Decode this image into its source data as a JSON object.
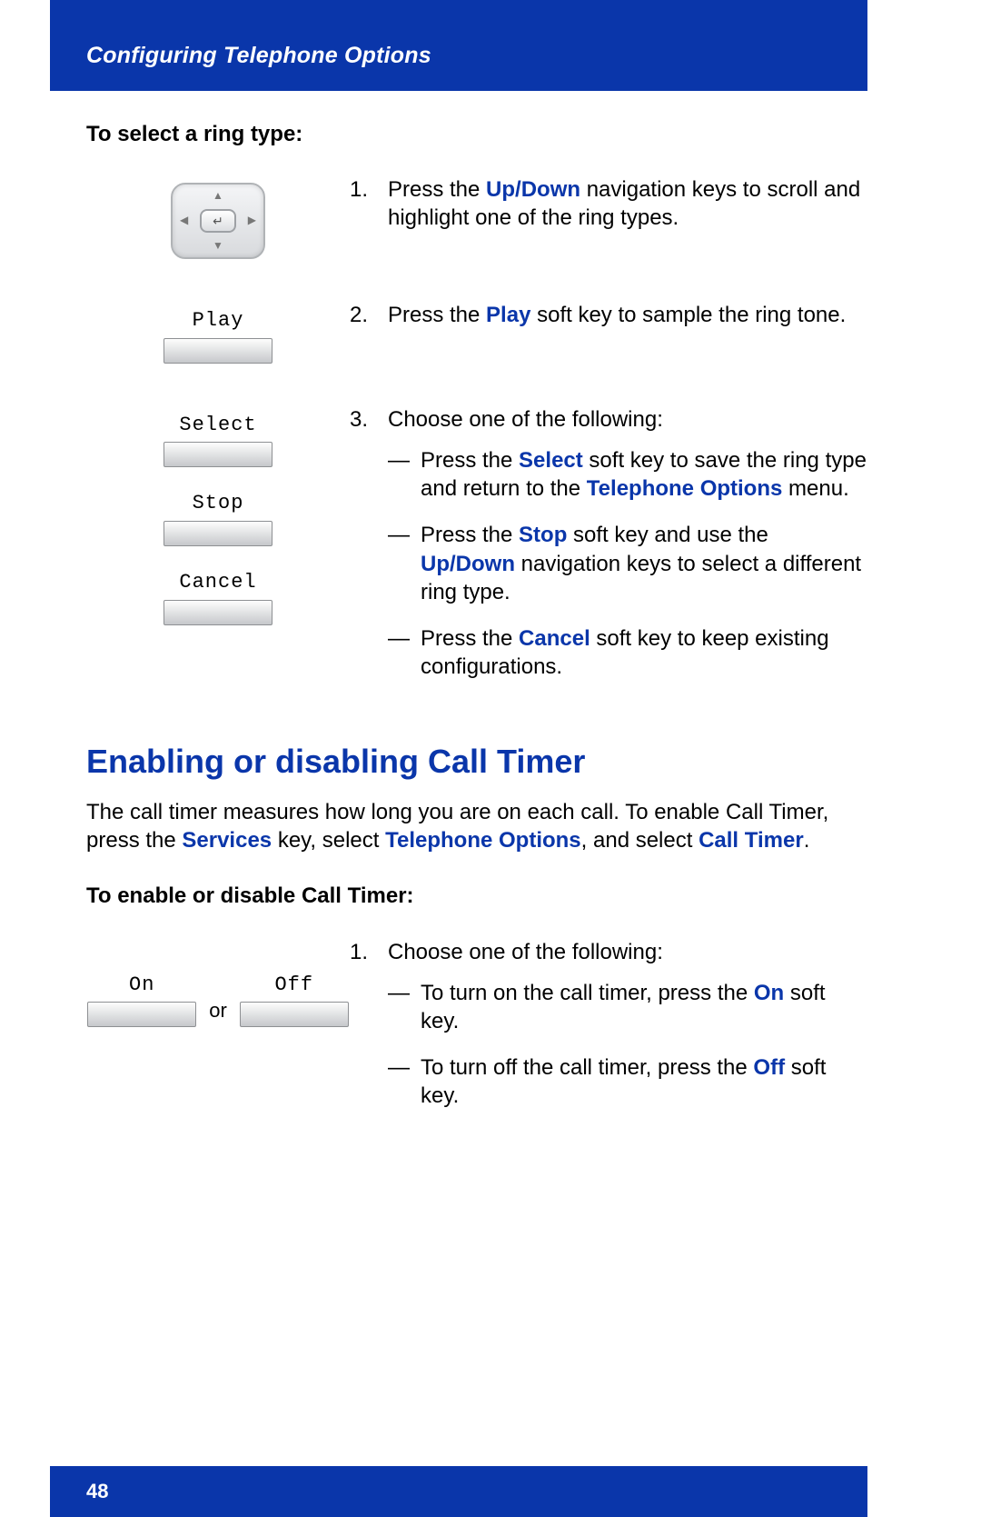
{
  "header": {
    "title": "Configuring Telephone Options"
  },
  "section1": {
    "subhead": "To select a ring type:",
    "steps": {
      "s1": {
        "num": "1.",
        "t1": "Press the ",
        "hl1": "Up/Down",
        "t2": " navigation keys to scroll and highlight one of the ring types."
      },
      "s2": {
        "num": "2.",
        "label": "Play",
        "t1": "Press the ",
        "hl1": "Play",
        "t2": " soft key to sample the ring tone."
      },
      "s3": {
        "num": "3.",
        "labels": {
          "a": "Select",
          "b": "Stop",
          "c": "Cancel"
        },
        "intro": "Choose one of the following:",
        "a": {
          "dash": "—",
          "t1": "Press the ",
          "hl1": "Select",
          "t2": " soft key to save the ring type and return to the ",
          "hl2": "Telephone Options",
          "t3": " menu."
        },
        "b": {
          "dash": "—",
          "t1": "Press the ",
          "hl1": "Stop",
          "t2": " soft key and use the ",
          "hl2": "Up/Down",
          "t3": " navigation keys to select a different ring type."
        },
        "c": {
          "dash": "—",
          "t1": "Press the ",
          "hl1": "Cancel",
          "t2": " soft key to keep existing configurations."
        }
      }
    }
  },
  "section2": {
    "title": "Enabling or disabling Call Timer",
    "para": {
      "t1": "The call timer measures how long you are on each call. To enable Call Timer, press the ",
      "hl1": "Services",
      "t2": " key, select ",
      "hl2": "Telephone Options",
      "t3": ", and select ",
      "hl3": "Call Timer",
      "t4": "."
    },
    "subhead": "To enable or disable Call Timer:",
    "step": {
      "num": "1.",
      "labels": {
        "on": "On",
        "off": "Off",
        "or": "or"
      },
      "intro": "Choose one of the following:",
      "a": {
        "dash": "—",
        "t1": "To turn on the call timer, press the ",
        "hl1": "On",
        "t2": " soft key."
      },
      "b": {
        "dash": "—",
        "t1": "To turn off the call timer, press the ",
        "hl1": "Off",
        "t2": " soft key."
      }
    }
  },
  "footer": {
    "page": "48"
  }
}
